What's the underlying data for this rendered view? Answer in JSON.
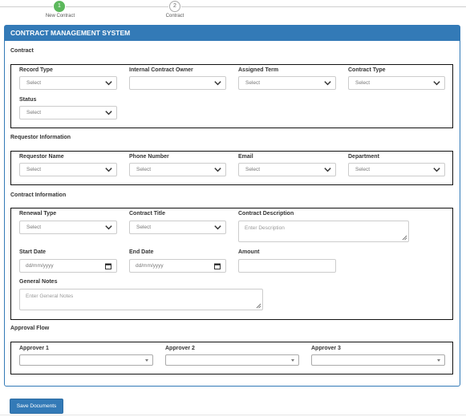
{
  "stepper": {
    "steps": [
      {
        "number": "1",
        "label": "New Contract",
        "active": true
      },
      {
        "number": "2",
        "label": "Contract",
        "active": false
      }
    ]
  },
  "panel": {
    "title": "CONTRACT MANAGEMENT SYSTEM"
  },
  "sections": {
    "contract": {
      "title": "Contract",
      "record_type": {
        "label": "Record Type",
        "value": "Select"
      },
      "internal_owner": {
        "label": "Internal Contract Owner",
        "value": ""
      },
      "assigned_term": {
        "label": "Assigned Term",
        "value": "Select"
      },
      "contract_type": {
        "label": "Contract Type",
        "value": "Select"
      },
      "status": {
        "label": "Status",
        "value": "Select"
      }
    },
    "requestor": {
      "title": "Requestor Information",
      "name": {
        "label": "Requestor Name",
        "value": "Select"
      },
      "phone": {
        "label": "Phone Number",
        "value": "Select"
      },
      "email": {
        "label": "Email",
        "value": "Select"
      },
      "department": {
        "label": "Department",
        "value": "Select"
      }
    },
    "contract_info": {
      "title": "Contract Information",
      "renewal_type": {
        "label": "Renewal Type",
        "value": "Select"
      },
      "contract_title": {
        "label": "Contract Title",
        "value": "Select"
      },
      "description": {
        "label": "Contract Description",
        "placeholder": "Enter Description"
      },
      "start_date": {
        "label": "Start Date",
        "placeholder": "dd/mm/yyyy"
      },
      "end_date": {
        "label": "End Date",
        "placeholder": "dd/mm/yyyy"
      },
      "amount": {
        "label": "Amount",
        "value": ""
      },
      "general_notes": {
        "label": "General Notes",
        "placeholder": "Enter General Notes"
      }
    },
    "approval": {
      "title": "Approval Flow",
      "approver1": {
        "label": "Approver 1"
      },
      "approver2": {
        "label": "Approver 2"
      },
      "approver3": {
        "label": "Approver 3"
      }
    }
  },
  "actions": {
    "save_label": "Save Documents"
  },
  "colors": {
    "primary": "#337ab7",
    "step_active": "#5cb85c"
  }
}
